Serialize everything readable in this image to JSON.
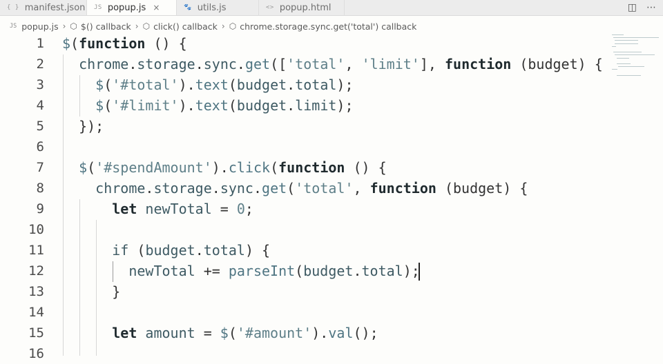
{
  "tabs": [
    {
      "icon": "{ }",
      "label": "manifest.json",
      "active": false
    },
    {
      "icon": "JS",
      "label": "popup.js",
      "active": true,
      "close": "×"
    },
    {
      "icon": "🐾",
      "label": "utils.js",
      "active": false
    },
    {
      "icon": "<>",
      "label": "popup.html",
      "active": false
    }
  ],
  "actions": {
    "split": "◫",
    "more": "⋯"
  },
  "breadcrumb": [
    {
      "icon": "JS",
      "label": "popup.js"
    },
    {
      "icon": "⬡",
      "label": "$() callback"
    },
    {
      "icon": "⬡",
      "label": "click() callback"
    },
    {
      "icon": "⬡",
      "label": "chrome.storage.sync.get('total') callback"
    }
  ],
  "breadcrumb_sep": "›",
  "lines": [
    {
      "n": "1",
      "t": [
        [
          "fn",
          "$"
        ],
        [
          "pn",
          "("
        ],
        [
          "kw",
          "function"
        ],
        [
          "pn",
          " () {"
        ]
      ]
    },
    {
      "n": "2",
      "t": [
        [
          "pn",
          "  "
        ],
        [
          "pl",
          "chrome"
        ],
        [
          "pn",
          "."
        ],
        [
          "pl",
          "storage"
        ],
        [
          "pn",
          "."
        ],
        [
          "pl",
          "sync"
        ],
        [
          "pn",
          "."
        ],
        [
          "fn",
          "get"
        ],
        [
          "pn",
          "(["
        ],
        [
          "st",
          "'total'"
        ],
        [
          "pn",
          ", "
        ],
        [
          "st",
          "'limit'"
        ],
        [
          "pn",
          "], "
        ],
        [
          "kw",
          "function"
        ],
        [
          "pn",
          " (budget) {"
        ]
      ]
    },
    {
      "n": "3",
      "t": [
        [
          "pn",
          "    "
        ],
        [
          "fn",
          "$"
        ],
        [
          "pn",
          "("
        ],
        [
          "st",
          "'#total'"
        ],
        [
          "pn",
          ")."
        ],
        [
          "fn",
          "text"
        ],
        [
          "pn",
          "("
        ],
        [
          "pl",
          "budget"
        ],
        [
          "pn",
          "."
        ],
        [
          "pl",
          "total"
        ],
        [
          "pn",
          ");"
        ]
      ]
    },
    {
      "n": "4",
      "t": [
        [
          "pn",
          "    "
        ],
        [
          "fn",
          "$"
        ],
        [
          "pn",
          "("
        ],
        [
          "st",
          "'#limit'"
        ],
        [
          "pn",
          ")."
        ],
        [
          "fn",
          "text"
        ],
        [
          "pn",
          "("
        ],
        [
          "pl",
          "budget"
        ],
        [
          "pn",
          "."
        ],
        [
          "pl",
          "limit"
        ],
        [
          "pn",
          ");"
        ]
      ]
    },
    {
      "n": "5",
      "t": [
        [
          "pn",
          "  });"
        ]
      ]
    },
    {
      "n": "6",
      "t": []
    },
    {
      "n": "7",
      "t": [
        [
          "pn",
          "  "
        ],
        [
          "fn",
          "$"
        ],
        [
          "pn",
          "("
        ],
        [
          "st",
          "'#spendAmount'"
        ],
        [
          "pn",
          ")."
        ],
        [
          "fn",
          "click"
        ],
        [
          "pn",
          "("
        ],
        [
          "kw",
          "function"
        ],
        [
          "pn",
          " () {"
        ]
      ]
    },
    {
      "n": "8",
      "t": [
        [
          "pn",
          "    "
        ],
        [
          "pl",
          "chrome"
        ],
        [
          "pn",
          "."
        ],
        [
          "pl",
          "storage"
        ],
        [
          "pn",
          "."
        ],
        [
          "pl",
          "sync"
        ],
        [
          "pn",
          "."
        ],
        [
          "fn",
          "get"
        ],
        [
          "pn",
          "("
        ],
        [
          "st",
          "'total'"
        ],
        [
          "pn",
          ", "
        ],
        [
          "kw",
          "function"
        ],
        [
          "pn",
          " (budget) {"
        ]
      ]
    },
    {
      "n": "9",
      "t": [
        [
          "pn",
          "      "
        ],
        [
          "kw",
          "let"
        ],
        [
          "pn",
          " "
        ],
        [
          "pl",
          "newTotal"
        ],
        [
          "pn",
          " = "
        ],
        [
          "st",
          "0"
        ],
        [
          "pn",
          ";"
        ]
      ]
    },
    {
      "n": "10",
      "t": []
    },
    {
      "n": "11",
      "t": [
        [
          "pn",
          "      "
        ],
        [
          "pl",
          "if"
        ],
        [
          "pn",
          " ("
        ],
        [
          "pl",
          "budget"
        ],
        [
          "pn",
          "."
        ],
        [
          "pl",
          "total"
        ],
        [
          "pn",
          ") {"
        ]
      ]
    },
    {
      "n": "12",
      "t": [
        [
          "pn",
          "        "
        ],
        [
          "pl",
          "newTotal"
        ],
        [
          "pn",
          " += "
        ],
        [
          "fn",
          "parseInt"
        ],
        [
          "pn",
          "("
        ],
        [
          "pl",
          "budget"
        ],
        [
          "pn",
          "."
        ],
        [
          "pl",
          "total"
        ],
        [
          "pn",
          ");"
        ]
      ]
    },
    {
      "n": "13",
      "t": [
        [
          "pn",
          "      }"
        ]
      ]
    },
    {
      "n": "14",
      "t": []
    },
    {
      "n": "15",
      "t": [
        [
          "pn",
          "      "
        ],
        [
          "kw",
          "let"
        ],
        [
          "pn",
          " "
        ],
        [
          "pl",
          "amount"
        ],
        [
          "pn",
          " = "
        ],
        [
          "fn",
          "$"
        ],
        [
          "pn",
          "("
        ],
        [
          "st",
          "'#amount'"
        ],
        [
          "pn",
          ")."
        ],
        [
          "fn",
          "val"
        ],
        [
          "pn",
          "();"
        ]
      ]
    },
    {
      "n": "16",
      "t": []
    }
  ]
}
